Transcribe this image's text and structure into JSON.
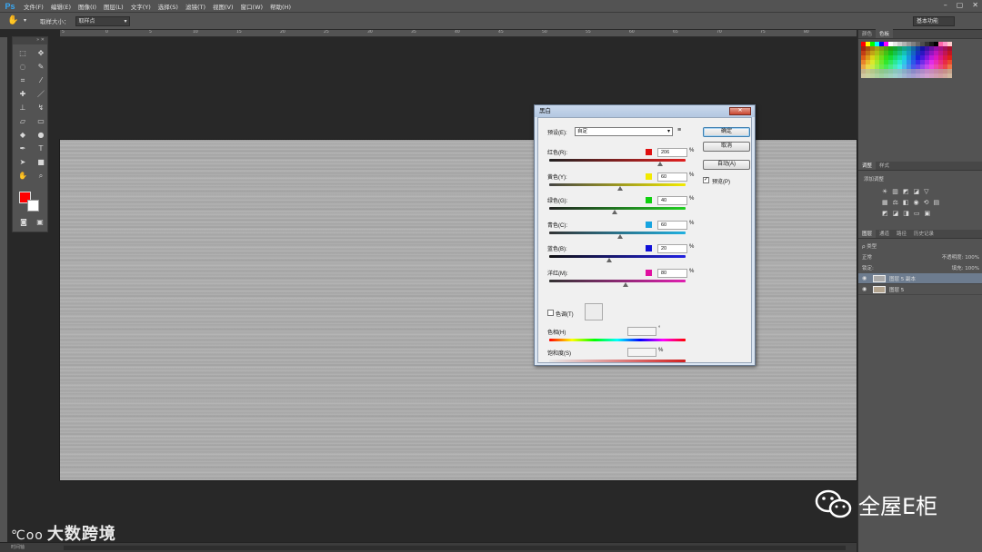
{
  "app": {
    "logo": "Ps"
  },
  "menu": [
    "文件(F)",
    "编辑(E)",
    "图像(I)",
    "图层(L)",
    "文字(Y)",
    "选择(S)",
    "滤镜(T)",
    "视图(V)",
    "窗口(W)",
    "帮助(H)"
  ],
  "options_bar": {
    "sample_label": "取样大小：",
    "sample_value": "取样点",
    "workspace": "基本功能"
  },
  "ruler_ticks": [
    "5",
    "0",
    "5",
    "10",
    "15",
    "20",
    "25",
    "30",
    "35",
    "40",
    "45",
    "50",
    "55",
    "60",
    "65",
    "70",
    "75",
    "80"
  ],
  "toolbox": {
    "fg_color": "#ff0000",
    "bg_color": "#ffffff"
  },
  "dialog": {
    "title": "黑白",
    "preset_label": "预设(E):",
    "preset_value": "自定",
    "buttons": {
      "ok": "确定",
      "cancel": "取消",
      "auto": "自动(A)"
    },
    "preview_label": "预览(P)",
    "preview_checked": true,
    "sliders": [
      {
        "label": "红色(R):",
        "value": "206",
        "color": "#e01010",
        "fraction": 0.81
      },
      {
        "label": "黄色(Y):",
        "value": "60",
        "color": "#f2ea00",
        "fraction": 0.52
      },
      {
        "label": "绿色(G):",
        "value": "40",
        "color": "#10d010",
        "fraction": 0.48
      },
      {
        "label": "青色(C):",
        "value": "60",
        "color": "#16a4e0",
        "fraction": 0.52
      },
      {
        "label": "蓝色(B):",
        "value": "20",
        "color": "#1010d8",
        "fraction": 0.44
      },
      {
        "label": "洋红(M):",
        "value": "80",
        "color": "#e010a0",
        "fraction": 0.56
      }
    ],
    "pct": "%",
    "tint_label": "色调(T)",
    "hue_label": "色相(H)",
    "hue_unit": "°",
    "sat_label": "饱和度(S)",
    "sat_unit": "%"
  },
  "panels": {
    "swatch_tabs": [
      "颜色",
      "色板"
    ],
    "adjust_tabs": [
      "调整",
      "样式"
    ],
    "adjust_label": "添加调整",
    "layer_tabs": [
      "图层",
      "通道",
      "路径",
      "历史记录"
    ],
    "filter_kind": "ρ 类型",
    "blend_mode": "正常",
    "opacity_label": "不透明度:",
    "opacity_value": "100%",
    "lock_label": "锁定:",
    "fill_label": "填充:",
    "fill_value": "100%",
    "layers": [
      {
        "name": "图层 5 副本",
        "selected": true
      },
      {
        "name": "图层 5",
        "selected": false
      }
    ]
  },
  "statusbar": {
    "timeline": "时间轴"
  },
  "watermarks": {
    "left_logo": "℃oo",
    "left_text": "大数跨境",
    "right_text": "全屋E柜"
  }
}
